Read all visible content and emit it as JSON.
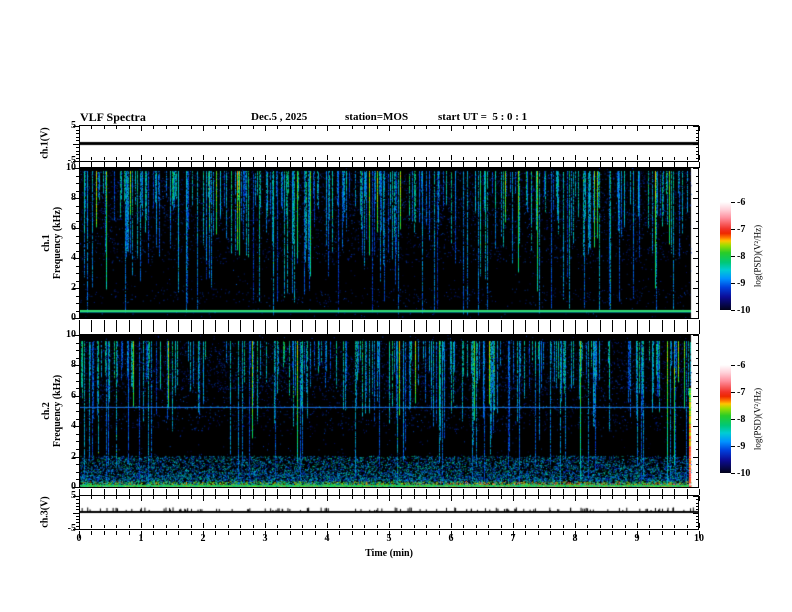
{
  "header": {
    "title": "VLF Spectra",
    "date": "Dec.5 , 2025",
    "station": "station=MOS",
    "start_ut": "start UT =  5 : 0 : 1"
  },
  "axes": {
    "time_label": "Time (min)",
    "time_ticks": [
      "0",
      "1",
      "2",
      "3",
      "4",
      "5",
      "6",
      "7",
      "8",
      "9",
      "10"
    ],
    "freq_ticks": [
      "10",
      "8",
      "6",
      "4",
      "2",
      "0"
    ],
    "volt_ticks": [
      "5",
      "-5"
    ]
  },
  "panels": {
    "ch1_voltage": {
      "label": "ch.1(V)"
    },
    "ch1_spec": {
      "label_ch": "ch.1",
      "label_axis": "Frequency (kHz)"
    },
    "ch2_spec": {
      "label_ch": "ch.2",
      "label_axis": "Frequency (kHz)"
    },
    "ch3_voltage": {
      "label": "ch.3(V)"
    }
  },
  "colorbar": {
    "label": "log(PSD)(V²/Hz)",
    "ticks": [
      "-6",
      "-7",
      "-8",
      "-9",
      "-10"
    ]
  },
  "colors": {
    "background": "#ffffff",
    "frame": "#000000",
    "spectrogram_background": "#000000",
    "carrier_line_green": "#33e077",
    "interference_line_blue": "#1a7dff",
    "colormap_top_to_bottom": [
      "white",
      "pink",
      "red",
      "orange",
      "yellow-green",
      "green",
      "cyan",
      "blue",
      "dark-navy"
    ]
  },
  "chart_data": [
    {
      "type": "line",
      "title": "ch.1 voltage waveform",
      "ylabel": "ch.1(V)",
      "xlim": [
        0,
        10
      ],
      "ylim": [
        -5,
        5
      ],
      "yticks": [
        5,
        -5
      ],
      "description": "flat heavy line at 0 V for the whole 10 minutes"
    },
    {
      "type": "heatmap",
      "title": "ch.1 VLF spectrogram",
      "ylabel": "Frequency (kHz)",
      "xlim": [
        0,
        10
      ],
      "ylim": [
        0,
        10
      ],
      "yticks": [
        0,
        2,
        4,
        6,
        8,
        10
      ],
      "colorbar_label": "log(PSD)(V²/Hz)",
      "colorbar_range": [
        -10,
        -6
      ],
      "features": [
        "black background near -10 (no signal)",
        "dense vertical sferic streaks mostly 6-10 kHz, blue/cyan with green cores",
        "some streaks extend down to 2-4 kHz, a few reach 0 kHz",
        "occasional red/orange hot pixels inside strong streaks",
        "solid bright green horizontal transmitter line at ~0.5 kHz across full record",
        "faint blue speckle rows near 1-1.5 kHz"
      ]
    },
    {
      "type": "heatmap",
      "title": "ch.2 VLF spectrogram",
      "ylabel": "Frequency (kHz)",
      "xlim": [
        0,
        10
      ],
      "ylim": [
        0,
        10
      ],
      "yticks": [
        0,
        2,
        4,
        6,
        8,
        10
      ],
      "colorbar_label": "log(PSD)(V²/Hz)",
      "colorbar_range": [
        -10,
        -6
      ],
      "features": [
        "black background near -10",
        "vertical sferic streaks mostly 6-10 kHz, blue/cyan/green, some full-height",
        "thin blue horizontal interference line at ~5.3 kHz",
        "broadband noise band 0-1 kHz, blue/cyan with green and red hot spots (stronger in right half)",
        "bright green line along the 0 kHz bottom edge",
        "bright green/red column at the far right edge of the record"
      ]
    },
    {
      "type": "line",
      "title": "ch.3 voltage waveform",
      "ylabel": "ch.3(V)",
      "xlim": [
        0,
        10
      ],
      "ylim": [
        -5,
        5
      ],
      "yticks": [
        5,
        -5
      ],
      "description": "flat line at 0 V with small positive noise spikes",
      "xlabel": "Time (min)",
      "xticks": [
        0,
        1,
        2,
        3,
        4,
        5,
        6,
        7,
        8,
        9,
        10
      ]
    }
  ]
}
